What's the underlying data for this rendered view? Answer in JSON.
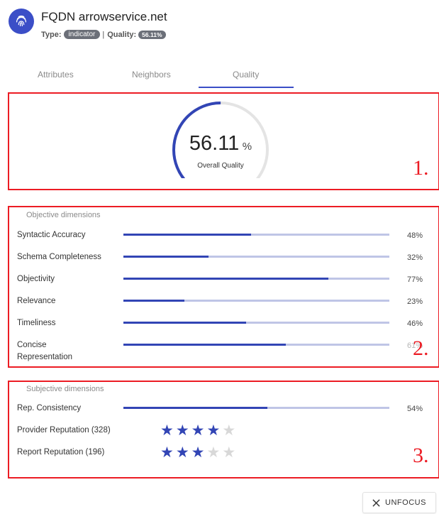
{
  "header": {
    "title": "FQDN arrowservice.net",
    "type_label": "Type:",
    "type_value": "indicator",
    "separator": "|",
    "quality_label": "Quality:",
    "quality_value": "56.11%",
    "avatar_icon": "fingerprint-icon"
  },
  "tabs": [
    {
      "label": "Attributes",
      "active": false
    },
    {
      "label": "Neighbors",
      "active": false
    },
    {
      "label": "Quality",
      "active": true
    }
  ],
  "overall": {
    "value": "56.11",
    "unit": "%",
    "label": "Overall Quality",
    "fraction": 0.5611,
    "box_number": "1."
  },
  "objective": {
    "title": "Objective dimensions",
    "box_number": "2.",
    "rows": [
      {
        "label": "Syntactic Accuracy",
        "percent": "48%",
        "value": 0.48
      },
      {
        "label": "Schema Completeness",
        "percent": "32%",
        "value": 0.32
      },
      {
        "label": "Objectivity",
        "percent": "77%",
        "value": 0.77
      },
      {
        "label": "Relevance",
        "percent": "23%",
        "value": 0.23
      },
      {
        "label": "Timeliness",
        "percent": "46%",
        "value": 0.46
      },
      {
        "label": "Concise Representation",
        "percent": "61%",
        "value": 0.61
      }
    ]
  },
  "subjective": {
    "title": "Subjective dimensions",
    "box_number": "3.",
    "consistency": {
      "label": "Rep. Consistency",
      "percent": "54%",
      "value": 0.54
    },
    "ratings": [
      {
        "label": "Provider Reputation (328)",
        "stars": 4,
        "max": 5
      },
      {
        "label": "Report Reputation (196)",
        "stars": 3,
        "max": 5
      }
    ]
  },
  "actions": {
    "unfocus_label": "UNFOCUS",
    "unfocus_icon": "close-icon"
  },
  "colors": {
    "accent": "#3245b5",
    "track": "#bfc5e6",
    "annotation": "#ec1c24"
  }
}
